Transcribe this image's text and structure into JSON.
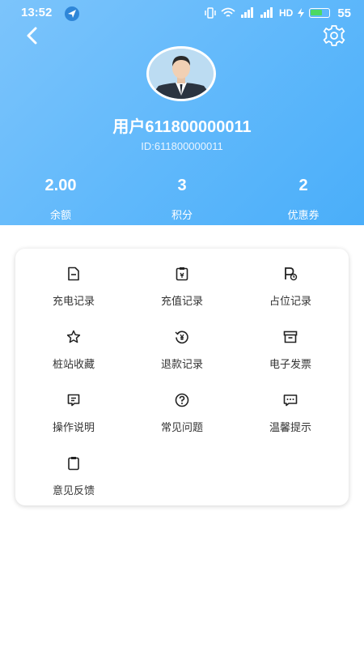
{
  "status_bar": {
    "time": "13:52",
    "network": "HD",
    "battery": "55",
    "battery_level": 0.55
  },
  "header": {
    "back_icon": "chevron-left-icon",
    "settings_icon": "gear-icon"
  },
  "profile": {
    "name": "用户611800000011",
    "id_text": "ID:611800000011"
  },
  "stats": [
    {
      "value": "2.00",
      "label": "余额"
    },
    {
      "value": "3",
      "label": "积分"
    },
    {
      "value": "2",
      "label": "优惠券"
    }
  ],
  "menu": [
    {
      "label": "充电记录",
      "icon": "document-icon"
    },
    {
      "label": "充值记录",
      "icon": "clipboard-icon"
    },
    {
      "label": "占位记录",
      "icon": "parking-icon"
    },
    {
      "label": "桩站收藏",
      "icon": "star-icon"
    },
    {
      "label": "退款记录",
      "icon": "refund-icon"
    },
    {
      "label": "电子发票",
      "icon": "invoice-box-icon"
    },
    {
      "label": "操作说明",
      "icon": "manual-icon"
    },
    {
      "label": "常见问题",
      "icon": "question-icon"
    },
    {
      "label": "温馨提示",
      "icon": "chat-icon"
    },
    {
      "label": "意见反馈",
      "icon": "feedback-icon"
    }
  ],
  "colors": {
    "header_gradient_start": "#7cc4fb",
    "header_gradient_end": "#4aaef9",
    "icon": "#222222"
  }
}
